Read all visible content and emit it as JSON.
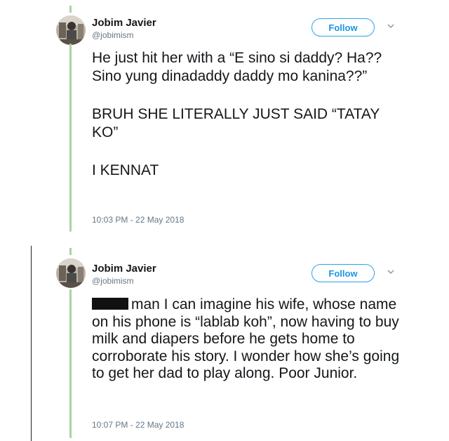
{
  "tweets": [
    {
      "author_name": "Jobim Javier",
      "author_handle": "@jobimism",
      "follow_label": "Follow",
      "paragraphs": [
        "He just hit her with a “E sino si daddy? Ha?? Sino yung dinadaddy daddy mo kanina??”",
        "BRUH SHE LITERALLY JUST SAID “TATAY KO”",
        "I KENNAT"
      ],
      "timestamp": "10:03 PM - 22 May 2018"
    },
    {
      "author_name": "Jobim Javier",
      "author_handle": "@jobimism",
      "follow_label": "Follow",
      "text_after_redaction": "man I can imagine his wife, whose name on his phone is “lablab koh”, now having to buy milk and diapers before he gets home to corroborate his story. I wonder how she’s going to get her dad to play along. Poor Junior.",
      "timestamp": "10:07 PM - 22 May 2018"
    }
  ],
  "colors": {
    "thread_line": "#a8d5a1",
    "follow_blue": "#1b95e0",
    "secondary_text": "#657786"
  },
  "icons": [
    "avatar",
    "chevron-down-icon"
  ]
}
